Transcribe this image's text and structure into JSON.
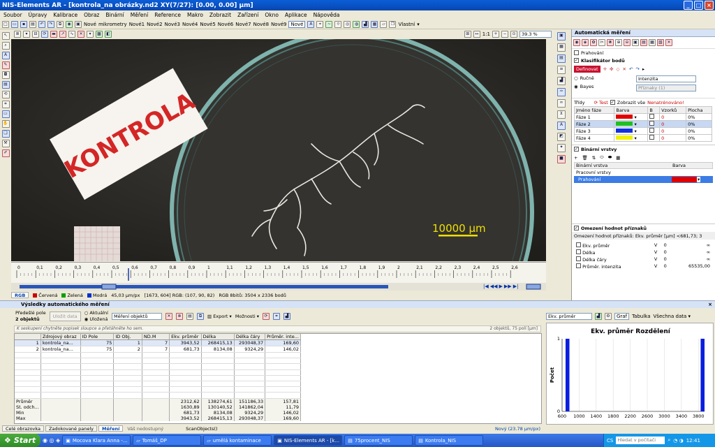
{
  "window": {
    "title": "NIS-Elements AR - [kontrola_na obrázky.nd2  XY(7/27): [0.00, 0.00] µm]"
  },
  "menu": [
    "Soubor",
    "Úpravy",
    "Kalibrace",
    "Obraz",
    "Binární",
    "Měření",
    "Reference",
    "Makro",
    "Zobrazit",
    "Zařízení",
    "Okno",
    "Aplikace",
    "Nápověda"
  ],
  "toolbar1": {
    "objectives": [
      "Nové",
      "mikrometry",
      "Nové1",
      "Nové2",
      "Nové3",
      "Nové4",
      "Nové5",
      "Nové6",
      "Nové7",
      "Nové8",
      "Nové9",
      "Nové"
    ],
    "vlastni": "Vlastní"
  },
  "toolbar2": {
    "onetoone": "1:1",
    "zoom": "39.3 %"
  },
  "image": {
    "label_text": "KONTROLA",
    "scalebar": "10000 µm"
  },
  "ruler": {
    "ticks": [
      "0",
      "0,1",
      "0,2",
      "0,3",
      "0,4",
      "0,5",
      "0,6",
      "0,7",
      "0,8",
      "0,9",
      "1",
      "1,1",
      "1,2",
      "1,3",
      "1,4",
      "1,5",
      "1,6",
      "1,7",
      "1,8",
      "1,9",
      "2",
      "2,1",
      "2,2",
      "2,3",
      "2,4",
      "2,5",
      "2,6"
    ]
  },
  "status": {
    "tabs": [
      "RGB",
      "Červená",
      "Zelená",
      "Modrá"
    ],
    "scale": "45,03 µm/px",
    "coords": "[1673, 604] RGB: (107, 90, 82)",
    "info": "RGB 8bitů: 3504 x 2336 bodů",
    "colors": {
      "red": "#cc0000",
      "green": "#00a000",
      "blue": "#0030cc"
    }
  },
  "auto_measure": {
    "title": "Automatická měření",
    "prahovani": "Prahování",
    "klasifikator": "Klasifikátor bodů",
    "definovat": "Definovat",
    "rucne": "Ručně",
    "bayes": "Bayes",
    "method": "Intenzita",
    "features": "Příznaky (1)",
    "tridy": "Třídy",
    "test": "Test",
    "show_all": "Zobrazit vše",
    "untrained": "Nenatrénováno!",
    "phase_headers": [
      "Jméno fáze",
      "Barva",
      "B",
      "Vzorků",
      "Plocha"
    ],
    "phases": [
      {
        "name": "Fáze 1",
        "color": "#e00000",
        "samples": "0",
        "area": "0%"
      },
      {
        "name": "Fáze 2",
        "color": "#20c020",
        "samples": "0",
        "area": "0%"
      },
      {
        "name": "Fáze 3",
        "color": "#1030e0",
        "samples": "0",
        "area": "0%"
      },
      {
        "name": "Fáze 4",
        "color": "#f0f000",
        "samples": "0",
        "area": "0%"
      }
    ],
    "binary_layers": "Binární vrstvy",
    "bl_headers": [
      "Binární vrstva",
      "Barva"
    ],
    "work_layers": "Pracovní vrstvy",
    "layer_row": "Prahování",
    "limits_title": "Omezení hodnot příznaků",
    "limits_line": "Omezení hodnot příznaků:  Ekv. průměr [µm]  <681,73; 3",
    "limits": [
      {
        "name": "Ekv. průměr",
        "v": "V",
        "min": "0",
        "max": "∞"
      },
      {
        "name": "Délka",
        "v": "V",
        "min": "0",
        "max": "∞"
      },
      {
        "name": "Délka čáry",
        "v": "V",
        "min": "0",
        "max": "∞"
      },
      {
        "name": "Průměr. intenzita",
        "v": "V",
        "min": "0",
        "max": "65535,00"
      }
    ]
  },
  "results": {
    "title": "Výsledky automatického měření",
    "prev_field": "Předešlé pole",
    "objects": "2 objektů",
    "save_data": "Uložit data",
    "current": "Aktuální",
    "saved": "Uložená",
    "measure_objects": "Měření objektů",
    "export": "Export",
    "options": "Možnosti",
    "hint": "K seskupení chytněte popisek sloupce a přetáhněte ho sem.",
    "summary": "2 objektů, 75 polí [µm]",
    "headers": [
      "",
      "Zdrojový obraz",
      "ID Pole",
      "ID Obj.",
      "ND.M",
      "Ekv. průměr",
      "Délka",
      "Délka čáry",
      "Průměr. inte..."
    ],
    "rows": [
      [
        "1",
        "kontrola_na...",
        "75",
        "1",
        "7",
        "3943,52",
        "268415,13",
        "293048,37",
        "169,60"
      ],
      [
        "2",
        "kontrola_na...",
        "75",
        "2",
        "7",
        "681,73",
        "8134,08",
        "9324,29",
        "146,02"
      ]
    ],
    "stats": [
      [
        "Průměr",
        "",
        "",
        "",
        "",
        "2312,62",
        "138274,61",
        "151186,33",
        "157,81"
      ],
      [
        "St. odch...",
        "",
        "",
        "",
        "",
        "1630,89",
        "130140,52",
        "141862,04",
        "11,79"
      ],
      [
        "Min",
        "",
        "",
        "",
        "",
        "681,73",
        "8134,08",
        "9324,29",
        "146,02"
      ],
      [
        "Max",
        "",
        "",
        "",
        "",
        "3943,52",
        "268415,13",
        "293048,37",
        "169,60"
      ]
    ],
    "footer_tabs": [
      "Celé obrazovka",
      "Zadokované panely",
      "Měření"
    ],
    "footer_note": "Váš nedostupný",
    "footer_scan": "ScanObjects()",
    "footer_cal": "Nový (23.78 µm/px)"
  },
  "chart_panel": {
    "feature": "Ekv. průměr",
    "graf": "Graf",
    "tabulka": "Tabulka",
    "all_data": "Všechna data"
  },
  "chart_data": {
    "type": "bar",
    "title": "Ekv. průměr Rozdělení",
    "ylabel": "Počet",
    "xlabel": "",
    "x_ticks": [
      "600",
      "1000",
      "1400",
      "1800",
      "2200",
      "2600",
      "3000",
      "3400",
      "3800"
    ],
    "y_ticks": [
      "0",
      "1"
    ],
    "xlim": [
      600,
      3943.52
    ],
    "ylim": [
      0,
      1
    ],
    "bars": [
      {
        "x_start": 681.73,
        "x_end": 772.5,
        "value": 1
      },
      {
        "x_start": 3852.5,
        "x_end": 3943.52,
        "value": 1
      }
    ],
    "color": "#0a1ee0"
  },
  "taskbar": {
    "start": "Start",
    "tasks": [
      "Mocova Klara Anna -...",
      "Tomáš_DP",
      "umělá kontaminace",
      "NIS-Elements AR - [k...",
      "75procent_NIS",
      "Kontrola_NIS"
    ],
    "lang": "CS",
    "search": "Hledat v počítači",
    "time": "12:41"
  }
}
